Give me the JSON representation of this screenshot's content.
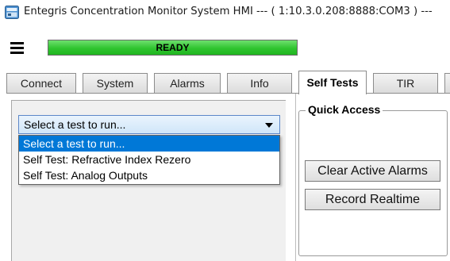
{
  "window": {
    "title": "Entegris Concentration Monitor System HMI --- ( 1:10.3.0.208:8888:COM3 ) ---"
  },
  "status": {
    "text": "READY",
    "color": "#2fc42f"
  },
  "tabs": [
    {
      "label": "Connect",
      "active": false
    },
    {
      "label": "System",
      "active": false
    },
    {
      "label": "Alarms",
      "active": false
    },
    {
      "label": "Info",
      "active": false
    },
    {
      "label": "Self Tests",
      "active": true
    },
    {
      "label": "TIR",
      "active": false
    }
  ],
  "test_select": {
    "value": "Select a test to run...",
    "options": [
      "Select a test to run...",
      "Self Test: Refractive Index Rezero",
      "Self Test: Analog Outputs"
    ]
  },
  "quick_access": {
    "title": "Quick Access",
    "buttons": [
      "Clear Active Alarms",
      "Record Realtime"
    ]
  },
  "icons": {
    "app": "app-window-icon",
    "menu": "hamburger-menu-icon",
    "dropdown": "chevron-down-icon"
  }
}
